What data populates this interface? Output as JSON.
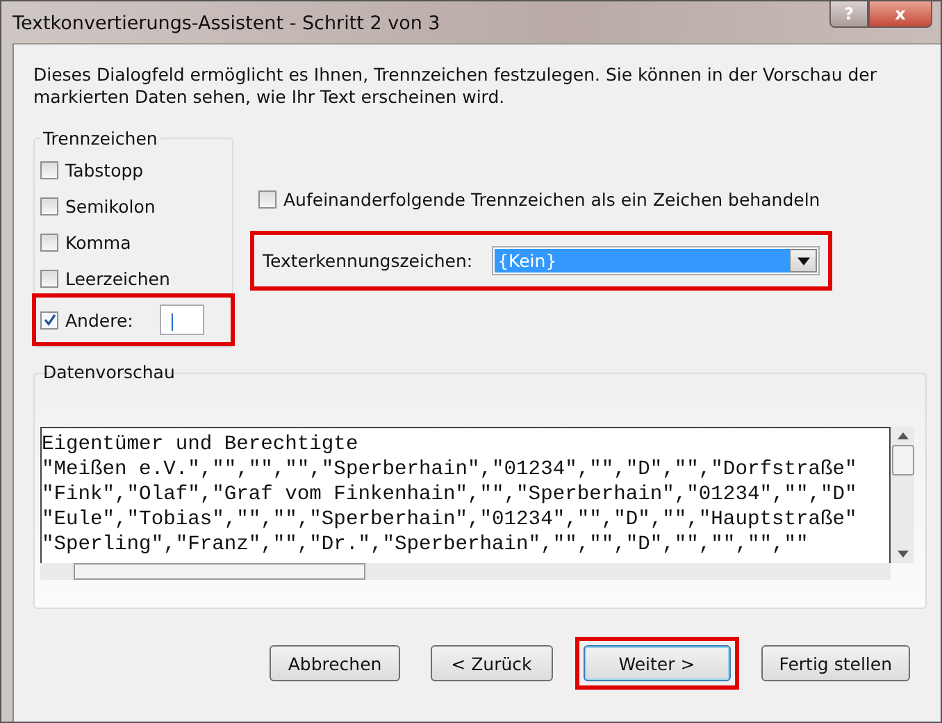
{
  "window": {
    "title": "Textkonvertierungs-Assistent - Schritt 2 von 3",
    "help_button": "?",
    "close_button": "x"
  },
  "description": "Dieses Dialogfeld ermöglicht es Ihnen, Trennzeichen festzulegen. Sie können in der Vorschau der markierten Daten sehen, wie Ihr Text erscheinen wird.",
  "delimiters": {
    "title": "Trennzeichen",
    "items": [
      {
        "label": "Tabstopp",
        "checked": false,
        "highlighted": false
      },
      {
        "label": "Semikolon",
        "checked": false,
        "highlighted": false
      },
      {
        "label": "Komma",
        "checked": false,
        "highlighted": false
      },
      {
        "label": "Leerzeichen",
        "checked": false,
        "highlighted": false
      },
      {
        "label": "Andere:",
        "checked": true,
        "highlighted": true,
        "value": "|"
      }
    ]
  },
  "consecutive": {
    "label": "Aufeinanderfolgende Trennzeichen als ein Zeichen behandeln",
    "checked": false
  },
  "text_qualifier": {
    "label": "Texterkennungszeichen:",
    "value": "{Kein}",
    "highlighted": true
  },
  "preview": {
    "title": "Datenvorschau",
    "lines": [
      "Eigentümer und Berechtigte",
      "\"Meißen e.V.\",\"\",\"\",\"\",\"Sperberhain\",\"01234\",\"\",\"D\",\"\",\"Dorfstraße\"",
      "\"Fink\",\"Olaf\",\"Graf vom Finkenhain\",\"\",\"Sperberhain\",\"01234\",\"\",\"D\"",
      "\"Eule\",\"Tobias\",\"\",\"\",\"Sperberhain\",\"01234\",\"\",\"D\",\"\",\"Hauptstraße\"",
      "\"Sperling\",\"Franz\",\"\",\"Dr.\",\"Sperberhain\",\"\",\"\",\"D\",\"\",\"\",\"\",\"\""
    ]
  },
  "buttons": [
    {
      "label": "Abbrechen",
      "highlighted": false
    },
    {
      "label": "< Zurück",
      "highlighted": false
    },
    {
      "label": "Weiter >",
      "highlighted": true
    },
    {
      "label": "Fertig stellen",
      "highlighted": false
    }
  ]
}
